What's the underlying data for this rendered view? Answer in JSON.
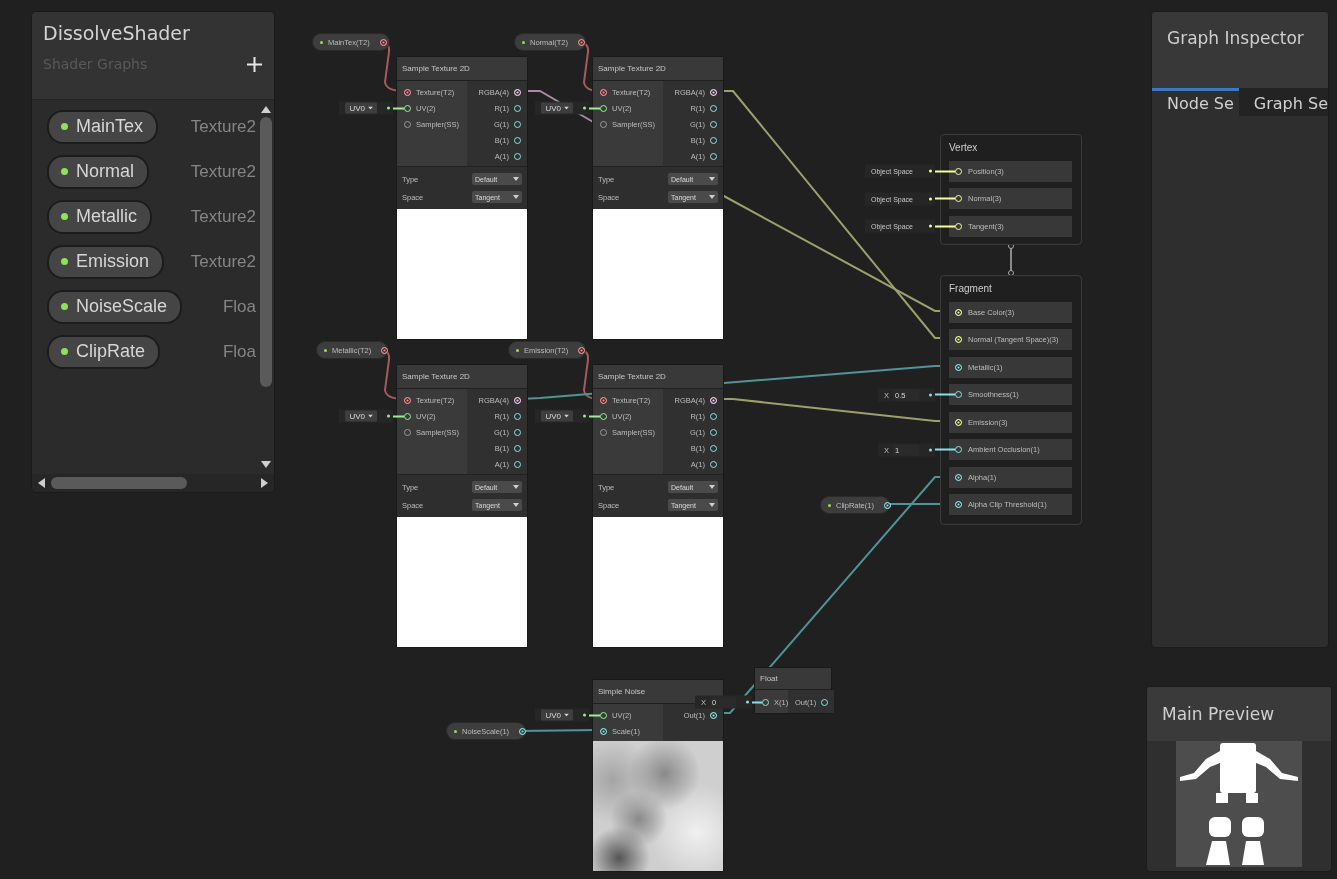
{
  "blackboard": {
    "title": "DissolveShader",
    "subtitle": "Shader Graphs",
    "properties": [
      {
        "name": "MainTex",
        "type": "Texture2"
      },
      {
        "name": "Normal",
        "type": "Texture2"
      },
      {
        "name": "Metallic",
        "type": "Texture2"
      },
      {
        "name": "Emission",
        "type": "Texture2"
      },
      {
        "name": "NoiseScale",
        "type": "Floa"
      },
      {
        "name": "ClipRate",
        "type": "Floa"
      }
    ]
  },
  "property_nodes": [
    {
      "label": "MainTex(T2)",
      "kind": "texture"
    },
    {
      "label": "Normal(T2)",
      "kind": "texture"
    },
    {
      "label": "Metallic(T2)",
      "kind": "texture"
    },
    {
      "label": "Emission(T2)",
      "kind": "texture"
    },
    {
      "label": "NoiseScale(1)",
      "kind": "float"
    },
    {
      "label": "ClipRate(1)",
      "kind": "float"
    }
  ],
  "sample_nodes": [
    {
      "title": "Sample Texture 2D",
      "inputs": [
        {
          "label": "Texture(T2)",
          "kind": "texture",
          "connected": true
        },
        {
          "label": "UV(2)",
          "kind": "vec2",
          "connected": false,
          "default": {
            "kind": "dropdown",
            "value": "UV0"
          }
        },
        {
          "label": "Sampler(SS)",
          "kind": "sampler",
          "connected": false
        }
      ],
      "outputs": [
        {
          "label": "RGBA(4)",
          "kind": "vec4",
          "connected": true
        },
        {
          "label": "R(1)",
          "kind": "float",
          "connected": false
        },
        {
          "label": "G(1)",
          "kind": "float",
          "connected": false
        },
        {
          "label": "B(1)",
          "kind": "float",
          "connected": false
        },
        {
          "label": "A(1)",
          "kind": "float",
          "connected": false
        }
      ],
      "settings": [
        {
          "label": "Type",
          "value": "Default"
        },
        {
          "label": "Space",
          "value": "Tangent"
        }
      ]
    },
    {
      "title": "Sample Texture 2D",
      "inputs": [
        {
          "label": "Texture(T2)",
          "kind": "texture",
          "connected": true
        },
        {
          "label": "UV(2)",
          "kind": "vec2",
          "connected": false,
          "default": {
            "kind": "dropdown",
            "value": "UV0"
          }
        },
        {
          "label": "Sampler(SS)",
          "kind": "sampler",
          "connected": false
        }
      ],
      "outputs": [
        {
          "label": "RGBA(4)",
          "kind": "vec4",
          "connected": true
        },
        {
          "label": "R(1)",
          "kind": "float",
          "connected": false
        },
        {
          "label": "G(1)",
          "kind": "float",
          "connected": false
        },
        {
          "label": "B(1)",
          "kind": "float",
          "connected": false
        },
        {
          "label": "A(1)",
          "kind": "float",
          "connected": false
        }
      ],
      "settings": [
        {
          "label": "Type",
          "value": "Default"
        },
        {
          "label": "Space",
          "value": "Tangent"
        }
      ]
    },
    {
      "title": "Sample Texture 2D",
      "inputs": [
        {
          "label": "Texture(T2)",
          "kind": "texture",
          "connected": true
        },
        {
          "label": "UV(2)",
          "kind": "vec2",
          "connected": false,
          "default": {
            "kind": "dropdown",
            "value": "UV0"
          }
        },
        {
          "label": "Sampler(SS)",
          "kind": "sampler",
          "connected": false
        }
      ],
      "outputs": [
        {
          "label": "RGBA(4)",
          "kind": "vec4",
          "connected": true
        },
        {
          "label": "R(1)",
          "kind": "float",
          "connected": false
        },
        {
          "label": "G(1)",
          "kind": "float",
          "connected": false
        },
        {
          "label": "B(1)",
          "kind": "float",
          "connected": false
        },
        {
          "label": "A(1)",
          "kind": "float",
          "connected": false
        }
      ],
      "settings": [
        {
          "label": "Type",
          "value": "Default"
        },
        {
          "label": "Space",
          "value": "Tangent"
        }
      ]
    },
    {
      "title": "Sample Texture 2D",
      "inputs": [
        {
          "label": "Texture(T2)",
          "kind": "texture",
          "connected": true
        },
        {
          "label": "UV(2)",
          "kind": "vec2",
          "connected": false,
          "default": {
            "kind": "dropdown",
            "value": "UV0"
          }
        },
        {
          "label": "Sampler(SS)",
          "kind": "sampler",
          "connected": false
        }
      ],
      "outputs": [
        {
          "label": "RGBA(4)",
          "kind": "vec4",
          "connected": true
        },
        {
          "label": "R(1)",
          "kind": "float",
          "connected": false
        },
        {
          "label": "G(1)",
          "kind": "float",
          "connected": false
        },
        {
          "label": "B(1)",
          "kind": "float",
          "connected": false
        },
        {
          "label": "A(1)",
          "kind": "float",
          "connected": false
        }
      ],
      "settings": [
        {
          "label": "Type",
          "value": "Default"
        },
        {
          "label": "Space",
          "value": "Tangent"
        }
      ]
    }
  ],
  "noise_node": {
    "title": "Simple Noise",
    "inputs": [
      {
        "label": "UV(2)",
        "kind": "vec2",
        "connected": false,
        "default": {
          "kind": "dropdown",
          "value": "UV0"
        }
      },
      {
        "label": "Scale(1)",
        "kind": "float",
        "connected": true
      }
    ],
    "outputs": [
      {
        "label": "Out(1)",
        "kind": "float",
        "connected": true
      }
    ]
  },
  "float_node": {
    "title": "Float",
    "inputs": [
      {
        "label": "X(1)",
        "kind": "float",
        "connected": false,
        "default": {
          "kind": "vector1",
          "axis": "X",
          "value": "0"
        }
      }
    ],
    "outputs": [
      {
        "label": "Out(1)",
        "kind": "float",
        "connected": false
      }
    ]
  },
  "master": {
    "vertex": {
      "title": "Vertex",
      "slots": [
        {
          "label": "Position(3)",
          "kind": "vec3",
          "connected": false,
          "default": {
            "kind": "space",
            "value": "Object Space"
          }
        },
        {
          "label": "Normal(3)",
          "kind": "vec3",
          "connected": false,
          "default": {
            "kind": "space",
            "value": "Object Space"
          }
        },
        {
          "label": "Tangent(3)",
          "kind": "vec3",
          "connected": false,
          "default": {
            "kind": "space",
            "value": "Object Space"
          }
        }
      ]
    },
    "fragment": {
      "title": "Fragment",
      "slots": [
        {
          "label": "Base Color(3)",
          "kind": "vec3",
          "connected": true
        },
        {
          "label": "Normal (Tangent Space)(3)",
          "kind": "vec3",
          "connected": true
        },
        {
          "label": "Metallic(1)",
          "kind": "float",
          "connected": true
        },
        {
          "label": "Smoothness(1)",
          "kind": "float",
          "connected": false,
          "default": {
            "kind": "vector1",
            "axis": "X",
            "value": "0.5"
          }
        },
        {
          "label": "Emission(3)",
          "kind": "vec3",
          "connected": true
        },
        {
          "label": "Ambient Occlusion(1)",
          "kind": "float",
          "connected": false,
          "default": {
            "kind": "vector1",
            "axis": "X",
            "value": "1"
          }
        },
        {
          "label": "Alpha(1)",
          "kind": "float",
          "connected": true
        },
        {
          "label": "Alpha Clip Threshold(1)",
          "kind": "float",
          "connected": true
        }
      ]
    }
  },
  "inspector": {
    "title": "Graph Inspector",
    "tabs": [
      {
        "label": "Node Se",
        "selected": true
      },
      {
        "label": "Graph Se",
        "selected": false
      }
    ]
  },
  "preview": {
    "title": "Main Preview"
  }
}
